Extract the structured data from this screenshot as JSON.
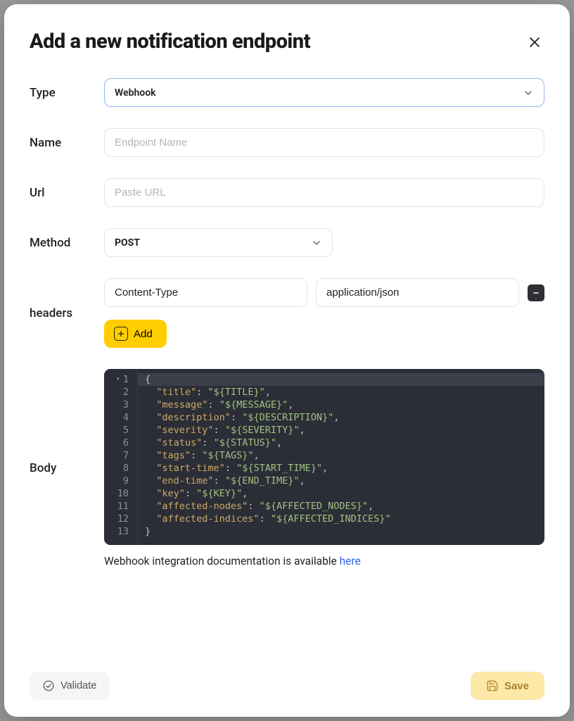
{
  "dialog": {
    "title": "Add a new notification endpoint"
  },
  "form": {
    "type": {
      "label": "Type",
      "value": "Webhook"
    },
    "name": {
      "label": "Name",
      "placeholder": "Endpoint Name",
      "value": ""
    },
    "url": {
      "label": "Url",
      "placeholder": "Paste URL",
      "value": ""
    },
    "method": {
      "label": "Method",
      "value": "POST"
    },
    "headers": {
      "label": "headers",
      "items": [
        {
          "key": "Content-Type",
          "value": "application/json"
        }
      ],
      "add_label": "Add"
    },
    "body": {
      "label": "Body",
      "lines": [
        {
          "n": "1",
          "raw": "{",
          "tokens": [
            {
              "t": "p",
              "v": "{"
            }
          ]
        },
        {
          "n": "2",
          "tokens": [
            {
              "t": "sp",
              "v": "  "
            },
            {
              "t": "k",
              "v": "\"title\""
            },
            {
              "t": "p",
              "v": ": "
            },
            {
              "t": "s",
              "v": "\"${TITLE}\""
            },
            {
              "t": "p",
              "v": ","
            }
          ]
        },
        {
          "n": "3",
          "tokens": [
            {
              "t": "sp",
              "v": "  "
            },
            {
              "t": "k",
              "v": "\"message\""
            },
            {
              "t": "p",
              "v": ": "
            },
            {
              "t": "s",
              "v": "\"${MESSAGE}\""
            },
            {
              "t": "p",
              "v": ","
            }
          ]
        },
        {
          "n": "4",
          "tokens": [
            {
              "t": "sp",
              "v": "  "
            },
            {
              "t": "k",
              "v": "\"description\""
            },
            {
              "t": "p",
              "v": ": "
            },
            {
              "t": "s",
              "v": "\"${DESCRIPTION}\""
            },
            {
              "t": "p",
              "v": ","
            }
          ]
        },
        {
          "n": "5",
          "tokens": [
            {
              "t": "sp",
              "v": "  "
            },
            {
              "t": "k",
              "v": "\"severity\""
            },
            {
              "t": "p",
              "v": ": "
            },
            {
              "t": "s",
              "v": "\"${SEVERITY}\""
            },
            {
              "t": "p",
              "v": ","
            }
          ]
        },
        {
          "n": "6",
          "tokens": [
            {
              "t": "sp",
              "v": "  "
            },
            {
              "t": "k",
              "v": "\"status\""
            },
            {
              "t": "p",
              "v": ": "
            },
            {
              "t": "s",
              "v": "\"${STATUS}\""
            },
            {
              "t": "p",
              "v": ","
            }
          ]
        },
        {
          "n": "7",
          "tokens": [
            {
              "t": "sp",
              "v": "  "
            },
            {
              "t": "k",
              "v": "\"tags\""
            },
            {
              "t": "p",
              "v": ": "
            },
            {
              "t": "s",
              "v": "\"${TAGS}\""
            },
            {
              "t": "p",
              "v": ","
            }
          ]
        },
        {
          "n": "8",
          "tokens": [
            {
              "t": "sp",
              "v": "  "
            },
            {
              "t": "k",
              "v": "\"start-time\""
            },
            {
              "t": "p",
              "v": ": "
            },
            {
              "t": "s",
              "v": "\"${START_TIME}\""
            },
            {
              "t": "p",
              "v": ","
            }
          ]
        },
        {
          "n": "9",
          "tokens": [
            {
              "t": "sp",
              "v": "  "
            },
            {
              "t": "k",
              "v": "\"end-time\""
            },
            {
              "t": "p",
              "v": ": "
            },
            {
              "t": "s",
              "v": "\"${END_TIME}\""
            },
            {
              "t": "p",
              "v": ","
            }
          ]
        },
        {
          "n": "10",
          "tokens": [
            {
              "t": "sp",
              "v": "  "
            },
            {
              "t": "k",
              "v": "\"key\""
            },
            {
              "t": "p",
              "v": ": "
            },
            {
              "t": "s",
              "v": "\"${KEY}\""
            },
            {
              "t": "p",
              "v": ","
            }
          ]
        },
        {
          "n": "11",
          "tokens": [
            {
              "t": "sp",
              "v": "  "
            },
            {
              "t": "k",
              "v": "\"affected-nodes\""
            },
            {
              "t": "p",
              "v": ": "
            },
            {
              "t": "s",
              "v": "\"${AFFECTED_NODES}\""
            },
            {
              "t": "p",
              "v": ","
            }
          ]
        },
        {
          "n": "12",
          "tokens": [
            {
              "t": "sp",
              "v": "  "
            },
            {
              "t": "k",
              "v": "\"affected-indices\""
            },
            {
              "t": "p",
              "v": ": "
            },
            {
              "t": "s",
              "v": "\"${AFFECTED_INDICES}\""
            }
          ]
        },
        {
          "n": "13",
          "tokens": [
            {
              "t": "p",
              "v": "}"
            }
          ]
        }
      ],
      "doc_text": "Webhook integration documentation is available ",
      "doc_link": "here"
    }
  },
  "footer": {
    "validate": "Validate",
    "save": "Save"
  }
}
